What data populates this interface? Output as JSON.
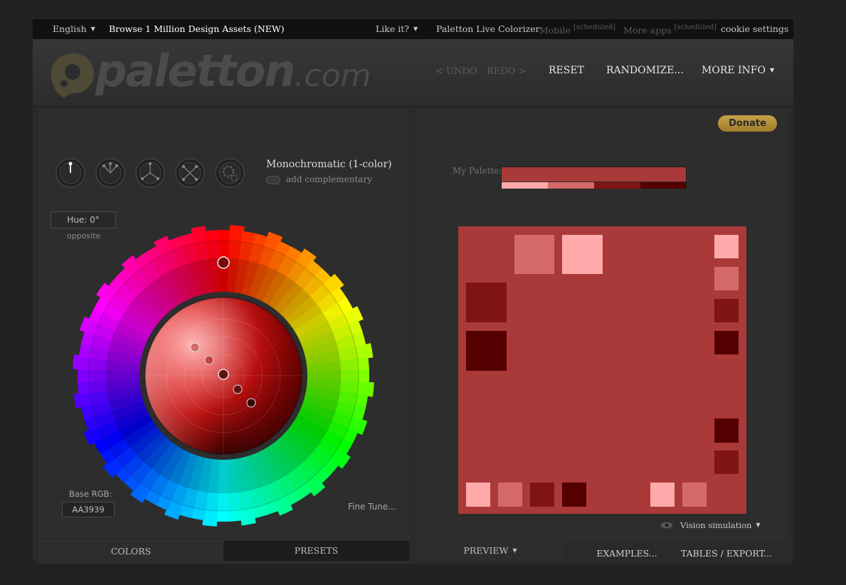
{
  "topbar": {
    "language": "English",
    "browse": "Browse 1 Million Design Assets (NEW)",
    "like": "Like it?",
    "live": "Paletton Live Colorizer",
    "mobile": "Mobile",
    "mobile_tag": "[scheduled]",
    "more_apps": "More apps",
    "more_apps_tag": "[scheduled]",
    "cookie": "cookie settings"
  },
  "header": {
    "logo_main": "paletton",
    "logo_tld": ".com",
    "undo": "< UNDO",
    "redo": "REDO >",
    "reset": "RESET",
    "randomize": "RANDOMIZE...",
    "more_info": "MORE INFO"
  },
  "donate": "Donate",
  "scheme": {
    "label": "Monochromatic (1-color)",
    "add_complementary": "add complementary",
    "icons": [
      "mono-icon",
      "adjacent-icon",
      "triad-icon",
      "tetrad-icon",
      "free-style-icon"
    ]
  },
  "hue": {
    "label": "Hue: 0°",
    "opposite": "opposite"
  },
  "base": {
    "label": "Base RGB:",
    "value": "AA3939"
  },
  "fine_tune": "Fine Tune...",
  "left_tabs": {
    "colors": "COLORS",
    "presets": "PRESETS"
  },
  "right_tabs": {
    "preview": "PREVIEW",
    "examples": "EXAMPLES...",
    "tables": "TABLES / EXPORT..."
  },
  "my_palette": {
    "label": "My Palette:",
    "main": "#AA3939",
    "shades": [
      "#FFAAAA",
      "#D46A6A",
      "#801515",
      "#550000"
    ]
  },
  "colors": {
    "base": "#AA3939",
    "lightest": "#FFAAAA",
    "light": "#D46A6A",
    "dark": "#801515",
    "darkest": "#550000",
    "donate": "#C49C3F"
  },
  "vision": "Vision simulation"
}
